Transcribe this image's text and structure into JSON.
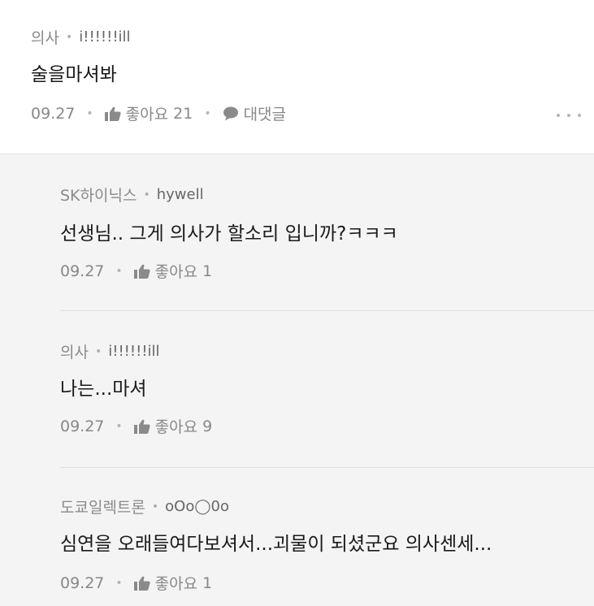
{
  "post": {
    "author_job": "의사",
    "author_nick": "i!!!!!!ill",
    "text": "술을마셔봐",
    "date": "09.27",
    "like_label": "좋아요",
    "like_count": "21",
    "reply_label": "대댓글"
  },
  "replies": [
    {
      "author_job": "SK하이닉스",
      "author_nick": "hywell",
      "text": "선생님.. 그게 의사가 할소리 입니까?ㅋㅋㅋ",
      "date": "09.27",
      "like_label": "좋아요",
      "like_count": "1"
    },
    {
      "author_job": "의사",
      "author_nick": "i!!!!!!ill",
      "text": "나는...마셔",
      "date": "09.27",
      "like_label": "좋아요",
      "like_count": "9"
    },
    {
      "author_job": "도쿄일렉트론",
      "author_nick": "oOo◯0o",
      "text": "심연을 오래들여다보셔서...괴물이 되셨군요 의사센세...",
      "date": "09.27",
      "like_label": "좋아요",
      "like_count": "1"
    }
  ],
  "icons": {
    "like": "thumbs-up-icon",
    "comment": "speech-bubble-icon",
    "more": "more-dots-icon"
  },
  "colors": {
    "post_bg": "#ffffff",
    "reply_bg": "#f4f4f5",
    "meta_text": "#8a8a8a",
    "body_text": "#1a1a1a"
  }
}
